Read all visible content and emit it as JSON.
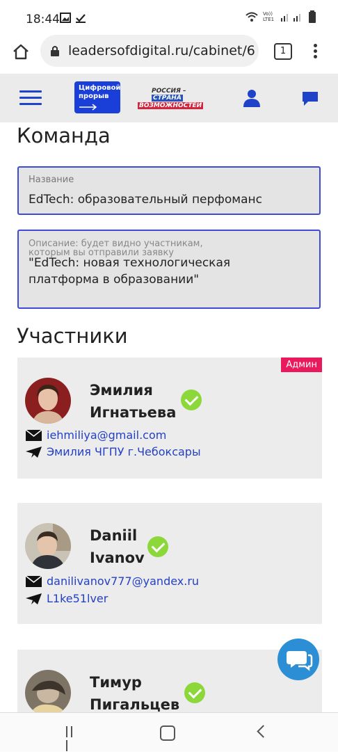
{
  "status": {
    "time": "18:44",
    "network_label": "Vo)) LTE1"
  },
  "browser": {
    "url": "leadersofdigital.ru/cabinet/6",
    "tab_count": "1"
  },
  "header": {
    "logo1_text": "Цифровой прорыв",
    "logo2_line1": "РОССИЯ –",
    "logo2_line2": "СТРАНА",
    "logo2_line3": "ВОЗМОЖНОСТЕЙ"
  },
  "team": {
    "heading": "Команда",
    "name_field": {
      "label": "Название",
      "value": "EdTech: образовательный перфоманс"
    },
    "desc_field": {
      "label": "Описание: будет видно участникам, которым вы отправили заявку",
      "value": "\"EdTech: новая технологическая платформа в образовании\""
    }
  },
  "participants": {
    "heading": "Участники",
    "items": [
      {
        "name_line1": "Эмилия",
        "name_line2": "Игнатьева",
        "badge": "Админ",
        "email": "iehmiliya@gmail.com",
        "telegram": "Эмилия ЧГПУ г.Чебоксары",
        "verified": true
      },
      {
        "name_line1": "Daniil",
        "name_line2": "Ivanov",
        "badge": "",
        "email": "danilivanov777@yandex.ru",
        "telegram": "L1ke51lver",
        "verified": true
      },
      {
        "name_line1": "Тимур",
        "name_line2": "Пигальцев",
        "badge": "",
        "email": "",
        "telegram": "",
        "verified": true
      }
    ]
  },
  "colors": {
    "accent": "#1f43c8",
    "badge": "#e8195c",
    "verified": "#8cd83a",
    "fab": "#2c8fd6"
  }
}
